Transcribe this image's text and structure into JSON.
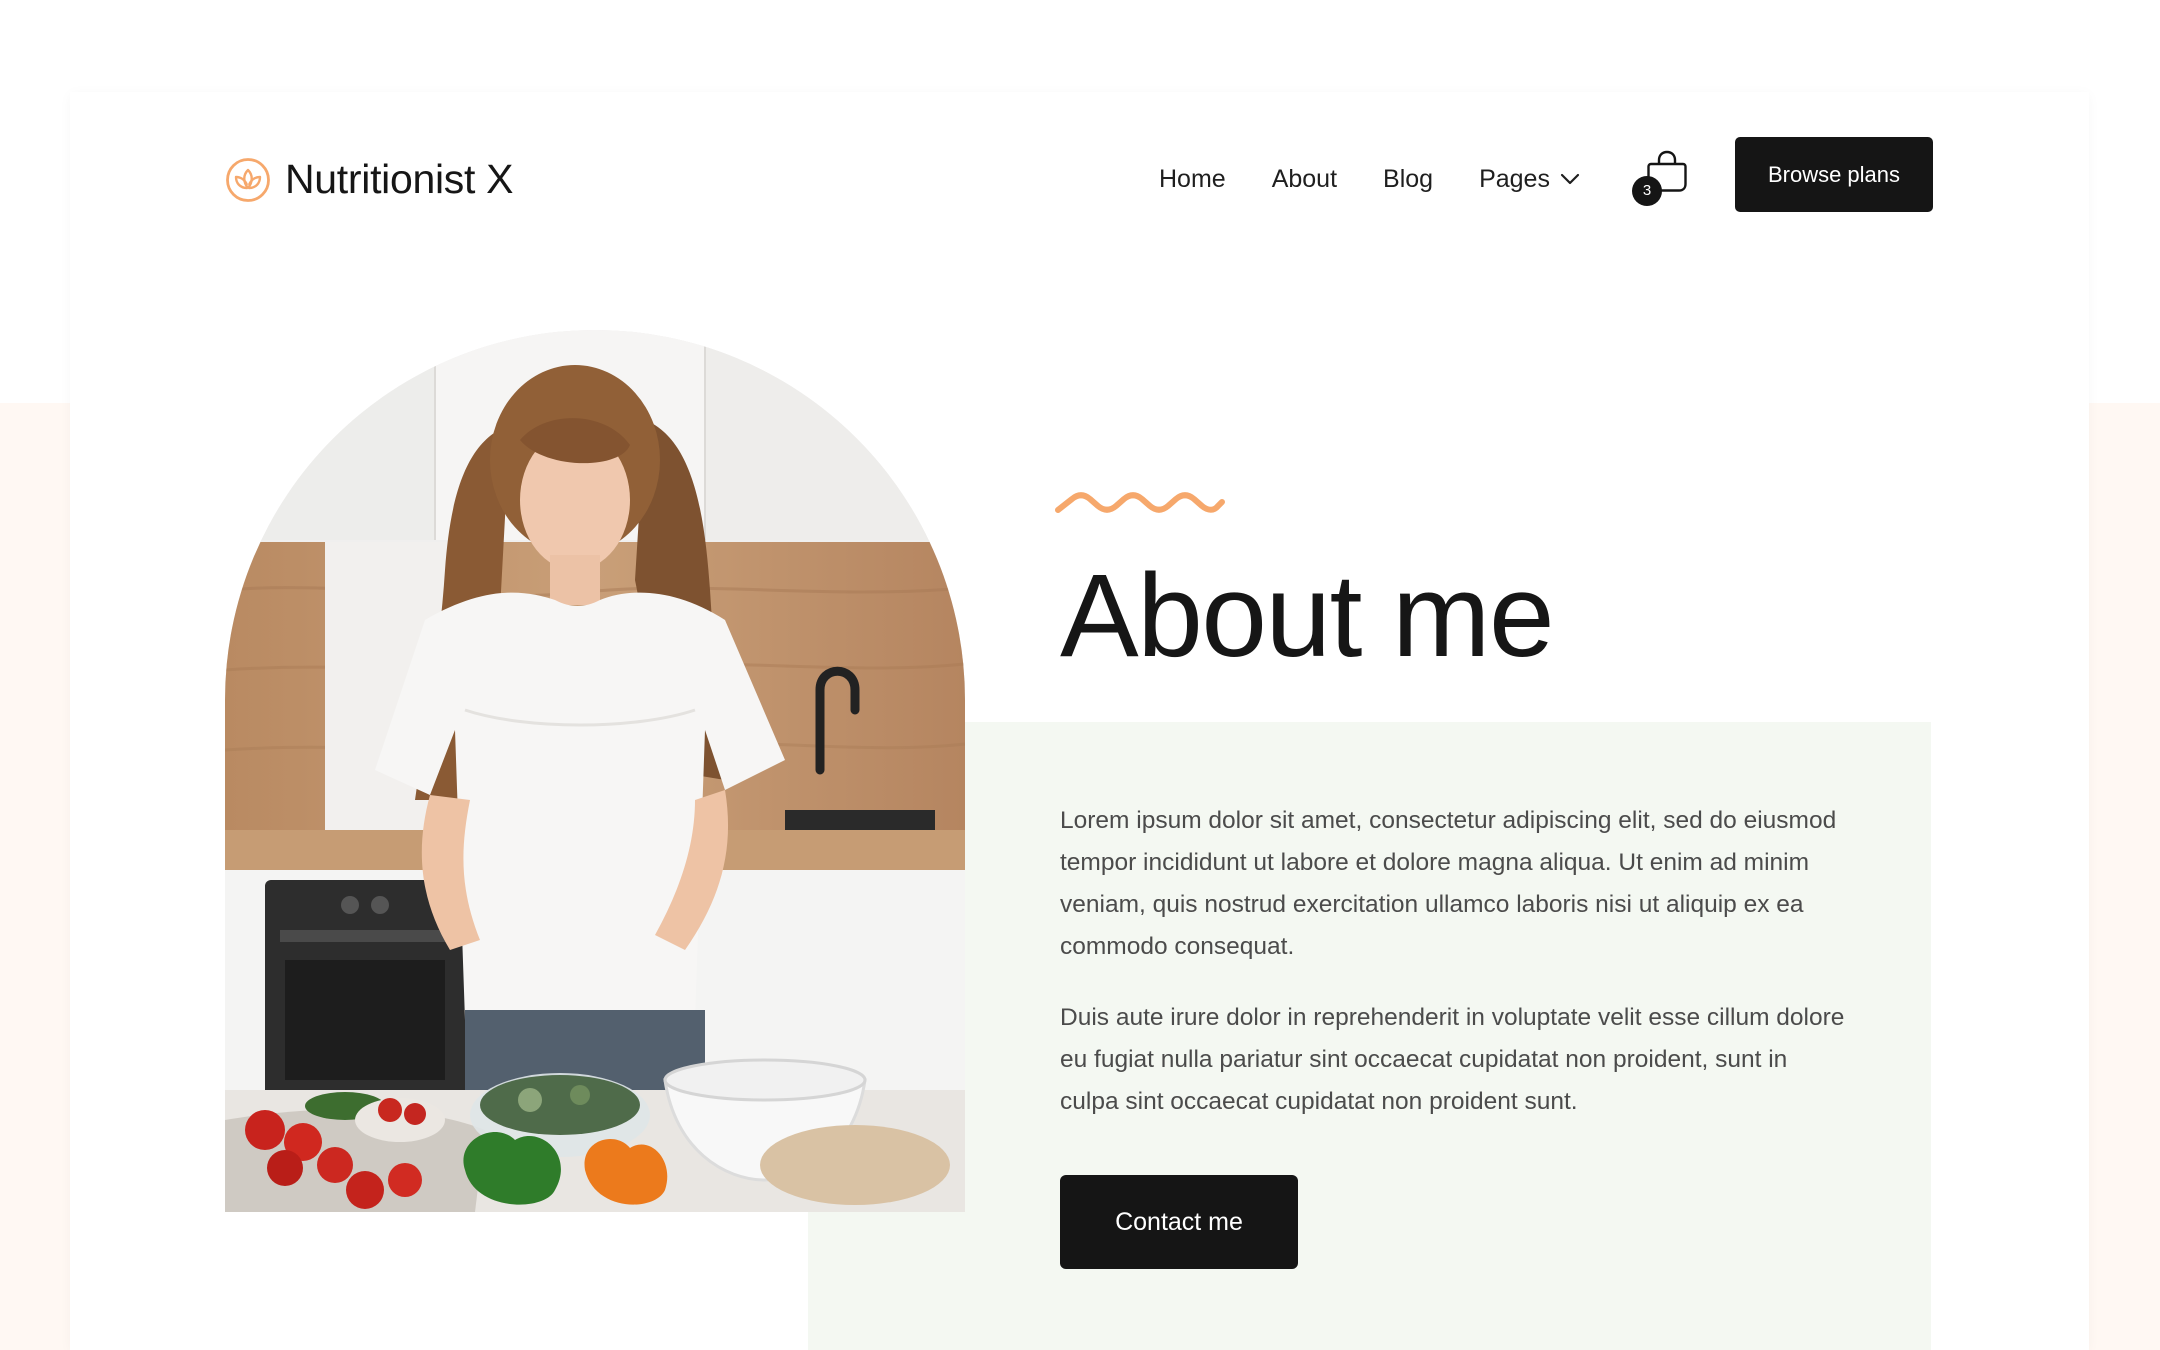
{
  "brand": {
    "name": "Nutritionist X",
    "logo_icon": "leaf-logo-icon",
    "accent": "#f6a86c"
  },
  "nav": {
    "items": [
      {
        "label": "Home"
      },
      {
        "label": "About"
      },
      {
        "label": "Blog"
      },
      {
        "label": "Pages",
        "icon": "chevron-down-icon"
      }
    ]
  },
  "cart": {
    "icon": "shopping-bag-icon",
    "count": "3"
  },
  "header_cta": {
    "label": "Browse plans"
  },
  "hero": {
    "image_icon": "woman-preparing-salad-photo",
    "decoration_icon": "zigzag-icon",
    "title": "About me",
    "paragraphs": [
      "Lorem ipsum dolor sit amet, consectetur adipiscing elit, sed do eiusmod tempor incididunt ut labore et dolore magna aliqua. Ut enim ad minim veniam, quis nostrud exercitation ullamco laboris nisi ut aliquip ex ea commodo consequat.",
      "Duis aute irure dolor in reprehenderit in voluptate velit esse cillum dolore eu fugiat nulla pariatur sint occaecat cupidatat non proident, sunt in culpa sint occaecat cupidatat non proident sunt."
    ],
    "cta": {
      "label": "Contact me"
    }
  },
  "colors": {
    "dark": "#151515",
    "peach_bg": "#fff8f3",
    "mint_bg": "#f4f8f2",
    "accent": "#f6a86c"
  }
}
